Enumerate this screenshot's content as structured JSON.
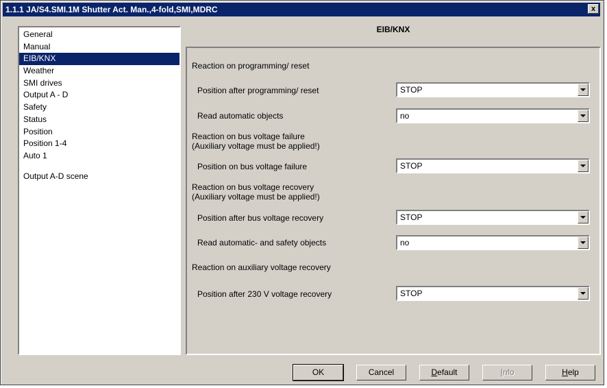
{
  "window": {
    "title": "1.1.1 JA/S4.SMI.1M Shutter Act. Man.,4-fold,SMI,MDRC",
    "close_label": "x"
  },
  "sidebar": {
    "items": [
      {
        "label": "General"
      },
      {
        "label": "Manual"
      },
      {
        "label": "EIB/KNX",
        "selected": true
      },
      {
        "label": "Weather"
      },
      {
        "label": "SMI drives"
      },
      {
        "label": "Output A - D"
      },
      {
        "label": "Safety"
      },
      {
        "label": "Status"
      },
      {
        "label": "Position"
      },
      {
        "label": "Position 1-4"
      },
      {
        "label": "Auto 1"
      },
      {
        "label": "Output A-D scene"
      }
    ]
  },
  "panel": {
    "title": "EIB/KNX",
    "section_programming": "Reaction on programming/ reset",
    "pos_after_programming": {
      "label": "Position after programming/ reset",
      "value": "STOP"
    },
    "read_automatic": {
      "label": "Read automatic objects",
      "value": "no"
    },
    "section_bus_failure": "Reaction on bus voltage failure",
    "section_bus_failure_note": "(Auxiliary voltage must be applied!)",
    "pos_bus_failure": {
      "label": "Position on bus voltage failure",
      "value": "STOP"
    },
    "section_bus_recovery": "Reaction on bus voltage recovery",
    "section_bus_recovery_note": "(Auxiliary voltage must be applied!)",
    "pos_bus_recovery": {
      "label": "Position after bus voltage recovery",
      "value": "STOP"
    },
    "read_auto_safety": {
      "label": "Read automatic- and safety objects",
      "value": "no"
    },
    "section_aux_recovery": "Reaction on auxiliary voltage recovery",
    "pos_230v_recovery": {
      "label": "Position after 230 V voltage recovery",
      "value": "STOP"
    }
  },
  "buttons": {
    "ok": "OK",
    "cancel": "Cancel",
    "default_first": "D",
    "default_rest": "efault",
    "info_first": "I",
    "info_rest": "nfo",
    "help_first": "H",
    "help_rest": "elp"
  }
}
